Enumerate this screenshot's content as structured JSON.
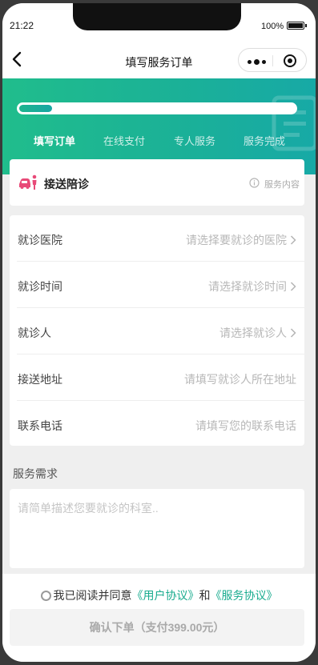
{
  "status_bar": {
    "time": "21:22",
    "battery": "100%"
  },
  "navbar": {
    "title": "填写服务订单"
  },
  "progress": {
    "value": 0.12
  },
  "steps": [
    "填写订单",
    "在线支付",
    "专人服务",
    "服务完成"
  ],
  "service": {
    "title": "接送陪诊",
    "link": "服务内容"
  },
  "form": {
    "rows": [
      {
        "label": "就诊医院",
        "placeholder": "请选择要就诊的医院"
      },
      {
        "label": "就诊时间",
        "placeholder": "请选择就诊时间"
      },
      {
        "label": "就诊人",
        "placeholder": "请选择就诊人"
      },
      {
        "label": "接送地址",
        "placeholder": "请填写就诊人所在地址"
      },
      {
        "label": "联系电话",
        "placeholder": "请填写您的联系电话"
      }
    ]
  },
  "needs": {
    "label": "服务需求",
    "placeholder": "请简单描述您要就诊的科室.."
  },
  "agreement": {
    "prefix": "我已阅读并同意",
    "user_link": "《用户协议》",
    "and": "和",
    "service_link": "《服务协议》"
  },
  "submit": {
    "label": "确认下单（支付399.00元）"
  },
  "colors": {
    "accent": "#1bb197",
    "car": "#e84a78"
  }
}
